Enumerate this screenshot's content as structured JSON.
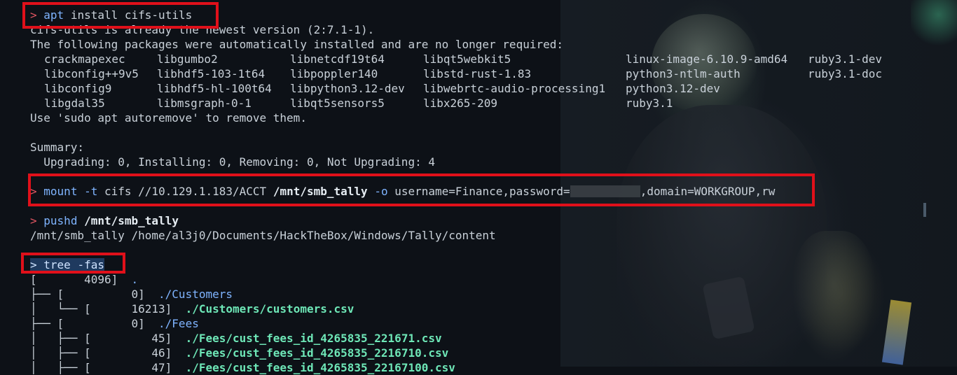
{
  "prompt_symbol": ">",
  "cmd1": {
    "keyword": "apt",
    "args": "install cifs-utils"
  },
  "output1": {
    "already_newest": "cifs-utils is already the newest version (2:7.1-1).",
    "following": "The following packages were automatically installed and are no longer required:",
    "packages": [
      [
        "crackmapexec",
        "libgumbo2",
        "libnetcdf19t64",
        "libqt5webkit5",
        "linux-image-6.10.9-amd64",
        "ruby3.1-dev"
      ],
      [
        "libconfig++9v5",
        "libhdf5-103-1t64",
        "libpoppler140",
        "libstd-rust-1.83",
        "python3-ntlm-auth",
        "ruby3.1-doc"
      ],
      [
        "libconfig9",
        "libhdf5-hl-100t64",
        "libpython3.12-dev",
        "libwebrtc-audio-processing1",
        "python3.12-dev",
        ""
      ],
      [
        "libgdal35",
        "libmsgraph-0-1",
        "libqt5sensors5",
        "libx265-209",
        "ruby3.1",
        ""
      ]
    ],
    "autoremove": "Use 'sudo apt autoremove' to remove them.",
    "summary_label": "Summary:",
    "summary_line": "  Upgrading: 0, Installing: 0, Removing: 0, Not Upgrading: 4"
  },
  "cmd2": {
    "keyword": "mount",
    "flag_t": "-t",
    "fstype": "cifs //10.129.1.183/ACCT",
    "mountpoint": "/mnt/smb_tally",
    "flag_o": "-o",
    "opts_pre": "username=Finance,password=",
    "opts_post": ",domain=WORKGROUP,rw"
  },
  "cmd3": {
    "keyword": "pushd",
    "path": "/mnt/smb_tally"
  },
  "output3": "/mnt/smb_tally /home/al3j0/Documents/HackTheBox/Windows/Tally/content",
  "cmd4": {
    "text": "tree -fas"
  },
  "tree": [
    {
      "prefix": "[       4096]  ",
      "name": ".",
      "kind": "dir"
    },
    {
      "prefix": "├── [          0]  ",
      "name": "./Customers",
      "kind": "dir"
    },
    {
      "prefix": "│   └── [      16213]  ",
      "name": "./Customers/customers.csv",
      "kind": "file"
    },
    {
      "prefix": "├── [          0]  ",
      "name": "./Fees",
      "kind": "dir"
    },
    {
      "prefix": "│   ├── [         45]  ",
      "name": "./Fees/cust_fees_id_4265835_221671.csv",
      "kind": "file"
    },
    {
      "prefix": "│   ├── [         46]  ",
      "name": "./Fees/cust_fees_id_4265835_2216710.csv",
      "kind": "file"
    },
    {
      "prefix": "│   ├── [         47]  ",
      "name": "./Fees/cust_fees_id_4265835_22167100.csv",
      "kind": "file"
    }
  ]
}
